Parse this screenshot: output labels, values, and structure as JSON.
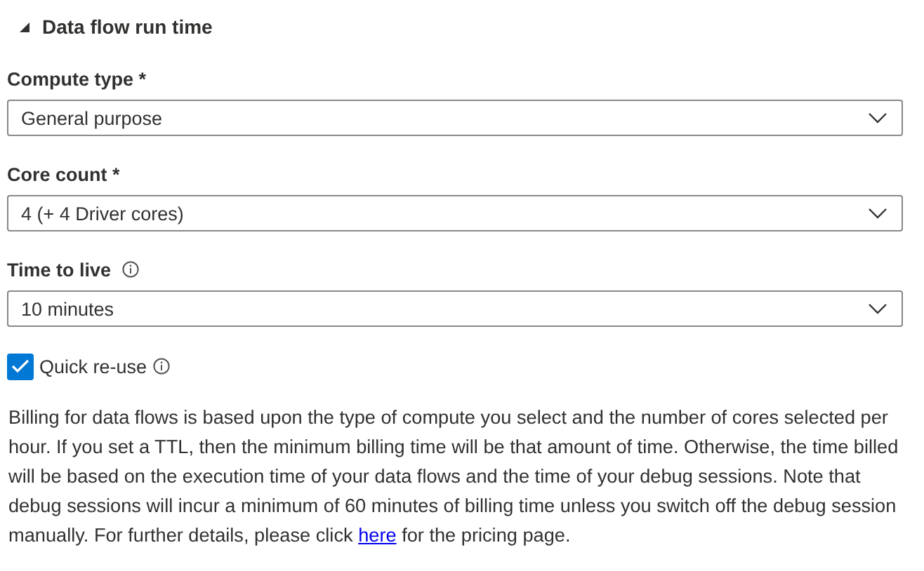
{
  "section": {
    "title": "Data flow run time",
    "expanded": true
  },
  "fields": [
    {
      "label": "Compute type *",
      "info": false,
      "value": "General purpose"
    },
    {
      "label": "Core count *",
      "info": false,
      "value": "4 (+ 4 Driver cores)"
    },
    {
      "label": "Time to live",
      "info": true,
      "value": "10 minutes"
    }
  ],
  "quick_reuse": {
    "label": "Quick re-use",
    "checked": true
  },
  "note": {
    "text": "Billing for data flows is based upon the type of compute you select and the number of cores selected per hour. If you set a TTL, then the minimum billing time will be that amount of time. Otherwise, the time billed will be based on the execution time of your data flows and the time of your debug sessions. Note that debug sessions will incur a minimum of 60 minutes of billing time unless you switch off the debug session manually. For further details, please click",
    "link": "here",
    "after": "for the pricing page."
  }
}
